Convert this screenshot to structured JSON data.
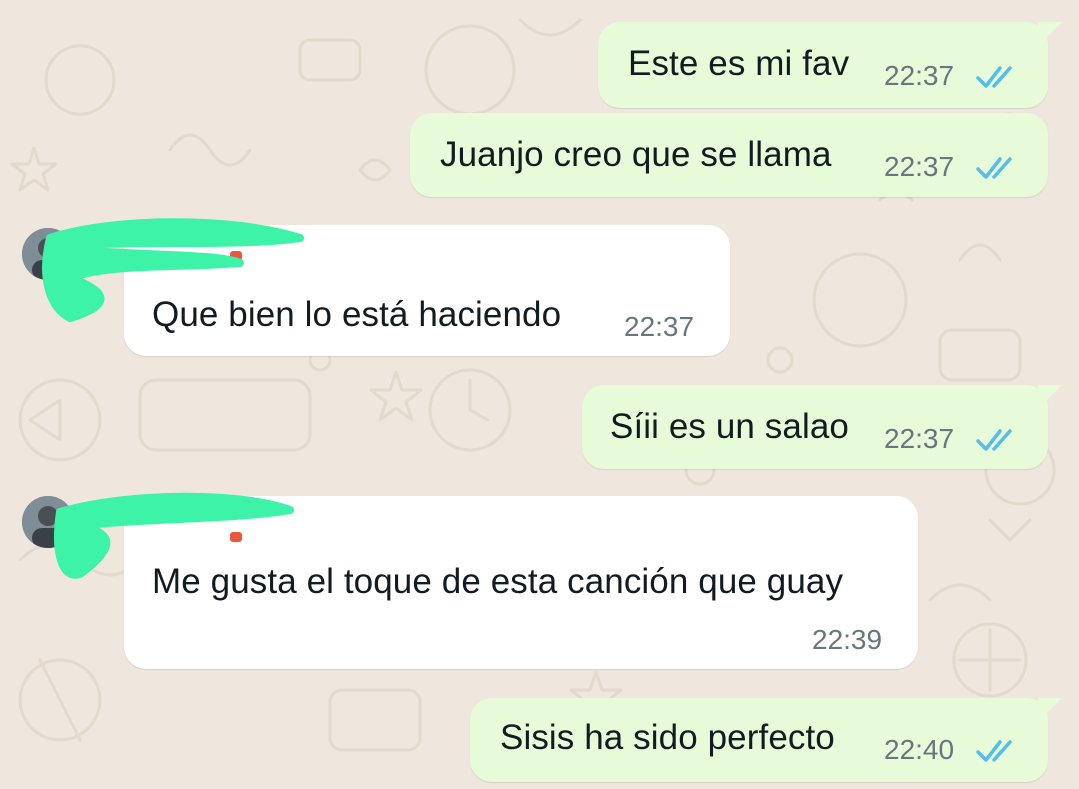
{
  "theme": {
    "background": "#efe7de",
    "outgoing_bubble": "#e7fbd8",
    "incoming_bubble": "#ffffff",
    "text_color": "#111b21",
    "time_color": "#667781",
    "read_tick_color": "#53bdeb",
    "redaction_color": "#3df3a8"
  },
  "messages": [
    {
      "direction": "outgoing",
      "text": "Este es mi fav",
      "time": "22:37",
      "status": "read",
      "status_icon": "double-check-icon"
    },
    {
      "direction": "outgoing",
      "text": "Juanjo creo que se llama",
      "time": "22:37",
      "status": "read",
      "status_icon": "double-check-icon"
    },
    {
      "direction": "incoming",
      "sender": "",
      "sender_redacted": true,
      "avatar_icon": "contact-avatar",
      "text": "Que bien lo está haciendo",
      "time": "22:37"
    },
    {
      "direction": "outgoing",
      "text": "Síii es un salao",
      "time": "22:37",
      "status": "read",
      "status_icon": "double-check-icon"
    },
    {
      "direction": "incoming",
      "sender": "",
      "sender_redacted": true,
      "avatar_icon": "contact-avatar",
      "text": "Me gusta el toque de esta canción que guay",
      "time": "22:39"
    },
    {
      "direction": "outgoing",
      "text": "Sisis ha sido perfecto",
      "time": "22:40",
      "status": "read",
      "status_icon": "double-check-icon"
    }
  ]
}
